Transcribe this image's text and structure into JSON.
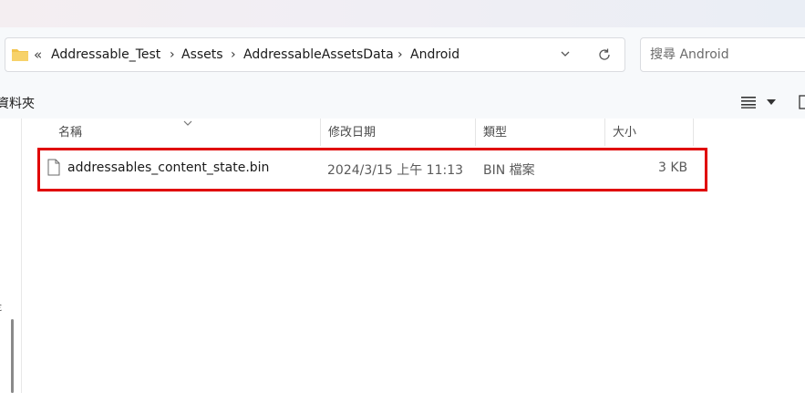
{
  "address_bar": {
    "overflow_glyph": "«",
    "crumbs": [
      "Addressable_Test",
      "Assets",
      "AddressableAssetsData",
      "Android"
    ],
    "separator": "›"
  },
  "search": {
    "placeholder": "搜尋 Android"
  },
  "toolbar": {
    "nav_pane_label": "資料夾"
  },
  "columns": {
    "name": "名稱",
    "modified": "修改日期",
    "type": "類型",
    "size": "大小"
  },
  "files": [
    {
      "name": "addressables_content_state.bin",
      "modified": "2024/3/15 上午 11:13",
      "type": "BIN 檔案",
      "size": "3 KB"
    }
  ],
  "left_pane_glyph": "ε",
  "colors": {
    "highlight": "#e00000",
    "folder": "#f2c44d",
    "window_bg": "#f7f9fb"
  },
  "icons": [
    "folder-icon",
    "chevron-down-icon",
    "refresh-icon",
    "view-list-icon",
    "details-pane-icon",
    "file-icon",
    "sort-indicator-icon"
  ]
}
